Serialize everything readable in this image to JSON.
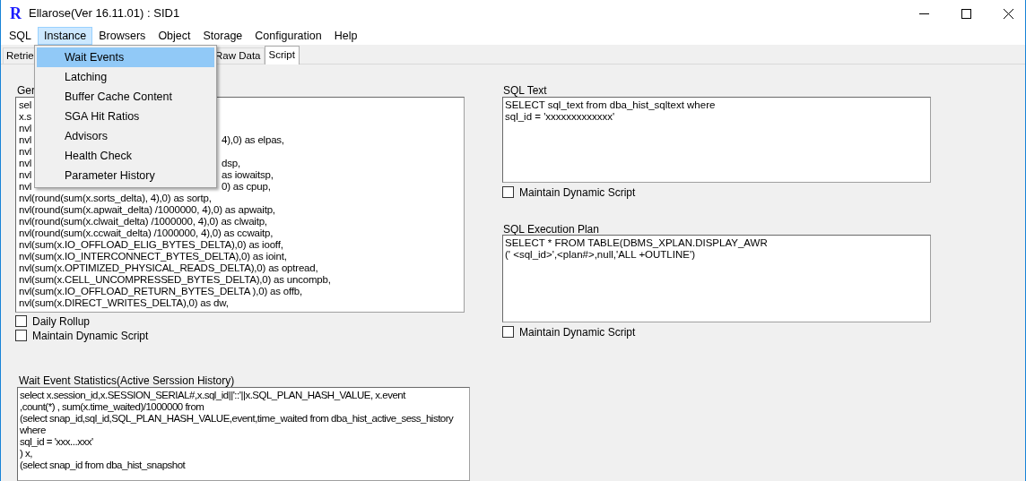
{
  "window": {
    "logo": "R",
    "title": "Ellarose(Ver 16.11.01) : SID1"
  },
  "menu_bar": [
    {
      "label": "SQL",
      "selected": false
    },
    {
      "label": "Instance",
      "selected": true
    },
    {
      "label": "Browsers",
      "selected": false
    },
    {
      "label": "Object",
      "selected": false
    },
    {
      "label": "Storage",
      "selected": false
    },
    {
      "label": "Configuration",
      "selected": false
    },
    {
      "label": "Help",
      "selected": false
    }
  ],
  "tabs": [
    {
      "label": "Retrie",
      "selected": false
    },
    {
      "label": "Raw Data",
      "selected": false
    },
    {
      "label": "Script",
      "selected": true
    }
  ],
  "instance_menu": [
    {
      "label": "Wait Events",
      "selected": true
    },
    {
      "label": "Latching",
      "selected": false
    },
    {
      "label": "Buffer Cache Content",
      "selected": false
    },
    {
      "label": "SGA Hit Ratios",
      "selected": false
    },
    {
      "label": "Advisors",
      "selected": false
    },
    {
      "label": "Health Check",
      "selected": false
    },
    {
      "label": "Parameter History",
      "selected": false
    }
  ],
  "general_panel": {
    "label": "Ger",
    "lines": [
      {
        "left": "sel"
      },
      {
        "left": "x.s"
      },
      {
        "left": "nvl"
      },
      {
        "left": "nvl",
        "right": "4),0) as elpas,"
      },
      {
        "left": "nvl"
      },
      {
        "left": "nvl",
        "right": "dsp,"
      },
      {
        "left": "nvl",
        "right": "as iowaitsp,"
      },
      {
        "left": "nvl",
        "right": "0) as cpup,"
      },
      {
        "left": "nvl(round(sum(x.sorts_delta), 4),0) as sortp,"
      },
      {
        "left": "nvl(round(sum(x.apwait_delta) /1000000, 4),0) as apwaitp,"
      },
      {
        "left": "nvl(round(sum(x.clwait_delta) /1000000, 4),0) as clwaitp,"
      },
      {
        "left": "nvl(round(sum(x.ccwait_delta) /1000000, 4),0) as ccwaitp,"
      },
      {
        "left": "nvl(sum(x.IO_OFFLOAD_ELIG_BYTES_DELTA),0) as iooff,"
      },
      {
        "left": "nvl(sum(x.IO_INTERCONNECT_BYTES_DELTA),0) as ioint,"
      },
      {
        "left": "nvl(sum(x.OPTIMIZED_PHYSICAL_READS_DELTA),0) as optread,"
      },
      {
        "left": "nvl(sum(x.CELL_UNCOMPRESSED_BYTES_DELTA),0) as uncompb,"
      },
      {
        "left": "nvl(sum(x.IO_OFFLOAD_RETURN_BYTES_DELTA ),0) as offb,"
      },
      {
        "left": "nvl(sum(x.DIRECT_WRITES_DELTA),0) as dw,"
      }
    ],
    "checkboxes": [
      {
        "label": "Daily Rollup",
        "checked": false
      },
      {
        "label": "Maintain Dynamic Script",
        "checked": false
      }
    ]
  },
  "wait_event_panel": {
    "label": "Wait Event Statistics(Active Serssion History)",
    "lines": [
      "select x.session_id,x.SESSION_SERIAL#,x.sql_id||'::'||x.SQL_PLAN_HASH_VALUE, x.event",
      ",count(*) , sum(x.time_waited)/1000000 from",
      "(select snap_id,sql_id,SQL_PLAN_HASH_VALUE,event,time_waited from dba_hist_active_sess_history",
      "where",
      "sql_id = 'xxx...xxx'",
      ") x,",
      "(select snap_id from dba_hist_snapshot"
    ]
  },
  "sql_text_panel": {
    "label": "SQL Text",
    "lines": [
      "SELECT sql_text from dba_hist_sqltext where",
      "sql_id = 'xxxxxxxxxxxxx'"
    ],
    "checkbox": {
      "label": "Maintain Dynamic Script",
      "checked": false
    }
  },
  "execution_plan_panel": {
    "label": "SQL Execution Plan",
    "lines": [
      "SELECT * FROM TABLE(DBMS_XPLAN.DISPLAY_AWR",
      "(' <sql_id>',<plan#>,null,'ALL +OUTLINE')"
    ],
    "checkbox": {
      "label": "Maintain Dynamic Script",
      "checked": false
    }
  }
}
